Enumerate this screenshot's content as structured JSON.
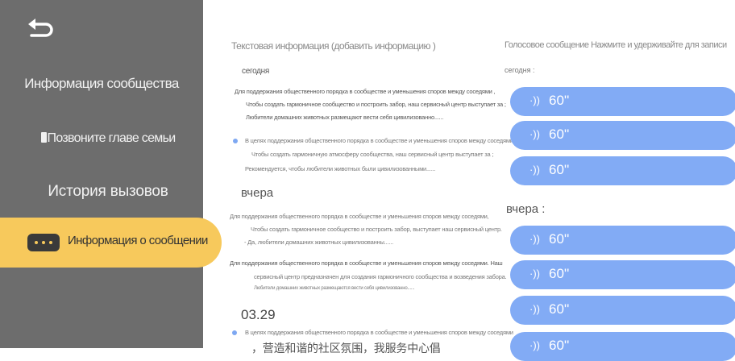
{
  "sidebar": {
    "items": [
      {
        "label": "Информация сообщества"
      },
      {
        "label": "Позвоните главе семьи"
      },
      {
        "label": "История вызовов"
      },
      {
        "label": "Информация о сообщении"
      }
    ]
  },
  "text_panel": {
    "title": "Текстовая информация (добавить информацию )",
    "groups": [
      {
        "date": "сегодня",
        "lines": [
          "Для поддержания общественного порядка в сообществе и уменьшения споров между соседями ,",
          "Чтобы создать гармоничное сообщество и построить забор, наш сервисный центр выступает за ;",
          "Любители домашних животных размещают вести себя цивилизованно......",
          "В целях поддержания общественного порядка в сообществе и уменьшения споров между соседями",
          "Чтобы создать гармоничную атмосферу сообщества, наш сервисный центр выступает за ;",
          "Рекомендуется, чтобы любители животных были цивилизованными......"
        ]
      },
      {
        "date": "вчера",
        "lines": [
          "Для поддержания общественного порядка в сообществе и уменьшения споров между соседями,",
          "Чтобы создать гармоничное сообщество и построить забор, выступает наш сервисный центр.",
          "- Да, любители домашних животных цивилизованны......",
          "Для поддержания общественного порядка в сообществе и уменьшения споров между соседями. Наш",
          "сервисный центр предназначен для создания гармоничного сообщества и возведения забора.",
          "Любители домашних животных размещаются вести себя цивилизованно......"
        ]
      },
      {
        "date": "03.29",
        "lines": [
          "В целях поддержания общественного порядка в сообществе и уменьшения споров между соседями",
          "，营造和谐的社区氛围，我服务中心倡"
        ]
      }
    ]
  },
  "voice_panel": {
    "title": "Голосовое сообщение Нажмите и удерживайте для записи",
    "groups": [
      {
        "date": "сегодня",
        "items": [
          "60''",
          "60''",
          "60''"
        ]
      },
      {
        "date": "вчера",
        "items": [
          "60''",
          "60''",
          "60''",
          "60''"
        ]
      }
    ]
  },
  "icons": {
    "back": "back-arrow-icon",
    "phone": "phone-icon",
    "message": "message-bubble-icon",
    "wave": "sound-wave-icon"
  },
  "colors": {
    "sidebar": "#6d6d6d",
    "active": "#f7c95c",
    "voice_button": "#82abf5"
  }
}
